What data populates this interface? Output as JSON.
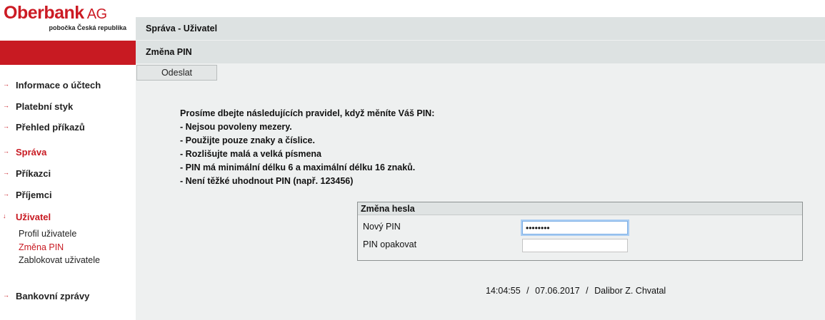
{
  "logo": {
    "name": "Oberbank",
    "suffix": "AG",
    "subtitle": "pobočka Česká republika"
  },
  "header": {
    "section": "Správa - Uživatel",
    "page": "Změna PIN"
  },
  "toolbar": {
    "submit_label": "Odeslat"
  },
  "nav": {
    "items": [
      {
        "label": "Informace o účtech",
        "arrow": "→"
      },
      {
        "label": "Platební styk",
        "arrow": "→"
      },
      {
        "label": "Přehled příkazů",
        "arrow": "→"
      },
      {
        "label": "Správa",
        "arrow": "→"
      },
      {
        "label": "Příkazci",
        "arrow": "→"
      },
      {
        "label": "Příjemci",
        "arrow": "→"
      },
      {
        "label": "Uživatel",
        "arrow": "↓"
      },
      {
        "label": "Bankovní zprávy",
        "arrow": "→"
      }
    ],
    "subitems": [
      {
        "label": "Profil uživatele"
      },
      {
        "label": "Změna PIN"
      },
      {
        "label": "Zablokovat uživatele"
      }
    ]
  },
  "rules": {
    "intro": "Prosíme dbejte následujících pravidel, když měníte Váš PIN:",
    "lines": [
      "- Nejsou povoleny mezery.",
      "- Použijte pouze znaky a číslice.",
      "- Rozlišujte malá a velká písmena",
      "- PIN má minimální délku 6 a maximální délku 16 znaků.",
      "- Není těžké uhodnout PIN (např. 123456)"
    ]
  },
  "form": {
    "title": "Změna hesla",
    "new_pin_label": "Nový PIN",
    "new_pin_value": "••••••••",
    "repeat_pin_label": "PIN opakovat",
    "repeat_pin_value": ""
  },
  "footer": {
    "time": "14:04:55",
    "date": "07.06.2017",
    "user": "Dalibor Z. Chvatal",
    "sep": "/"
  },
  "colors": {
    "brand_red": "#c81a22",
    "header_bg": "#dde2e2",
    "content_bg": "#eef0f0"
  }
}
